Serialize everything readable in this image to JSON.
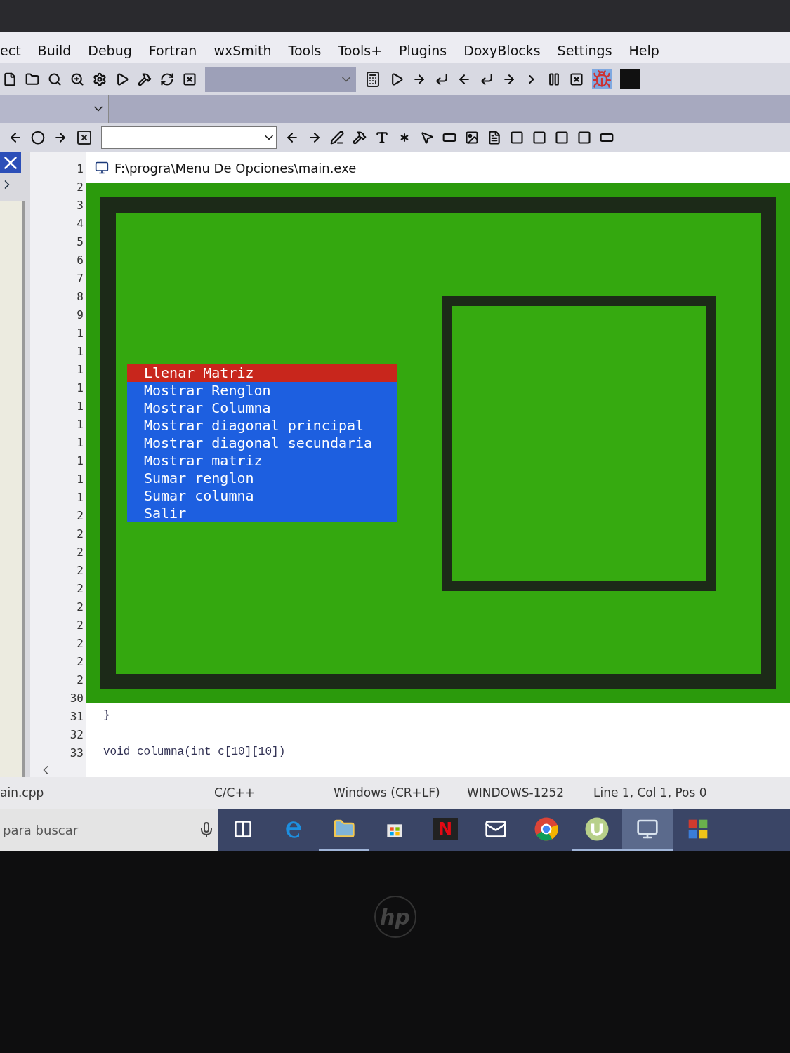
{
  "menu_bar": [
    "ect",
    "Build",
    "Debug",
    "Fortran",
    "wxSmith",
    "Tools",
    "Tools+",
    "Plugins",
    "DoxyBlocks",
    "Settings",
    "Help"
  ],
  "editor": {
    "line_numbers": [
      "1",
      "2",
      "3",
      "4",
      "5",
      "6",
      "7",
      "8",
      "9",
      "1",
      "1",
      "1",
      "1",
      "1",
      "1",
      "1",
      "1",
      "1",
      "1",
      "2",
      "2",
      "2",
      "2",
      "2",
      "2",
      "2",
      "2",
      "2",
      "2",
      "30",
      "31",
      "32",
      "33"
    ],
    "code_lines": [
      "}",
      "void columna(int c[10][10])"
    ]
  },
  "console": {
    "title": "F:\\progra\\Menu De Opciones\\main.exe",
    "menu": [
      {
        "label": "Llenar Matriz",
        "selected": true
      },
      {
        "label": "Mostrar Renglon",
        "selected": false
      },
      {
        "label": "Mostrar Columna",
        "selected": false
      },
      {
        "label": "Mostrar diagonal principal",
        "selected": false
      },
      {
        "label": "Mostrar diagonal secundaria",
        "selected": false
      },
      {
        "label": "Mostrar matriz",
        "selected": false
      },
      {
        "label": "Sumar renglon",
        "selected": false
      },
      {
        "label": "Sumar columna",
        "selected": false
      },
      {
        "label": "Salir",
        "selected": false
      }
    ]
  },
  "status_bar": {
    "file_tab": "ain.cpp",
    "language": "C/C++",
    "line_endings": "Windows (CR+LF)",
    "encoding": "WINDOWS-1252",
    "position": "Line 1, Col 1, Pos 0"
  },
  "taskbar": {
    "search": {
      "placeholder": "para buscar"
    },
    "apps": [
      {
        "kind": "taskview",
        "running": false,
        "selected": false
      },
      {
        "kind": "edge",
        "running": false,
        "selected": false
      },
      {
        "kind": "explorer",
        "running": true,
        "selected": false
      },
      {
        "kind": "store",
        "running": false,
        "selected": false
      },
      {
        "kind": "netflix",
        "label": "N",
        "running": false,
        "selected": false
      },
      {
        "kind": "mail",
        "running": false,
        "selected": false
      },
      {
        "kind": "chrome",
        "running": false,
        "selected": false
      },
      {
        "kind": "torrent",
        "running": true,
        "selected": false
      },
      {
        "kind": "window",
        "running": true,
        "selected": true
      },
      {
        "kind": "tiles",
        "running": false,
        "selected": false
      }
    ]
  },
  "bezel_logo": "hp"
}
